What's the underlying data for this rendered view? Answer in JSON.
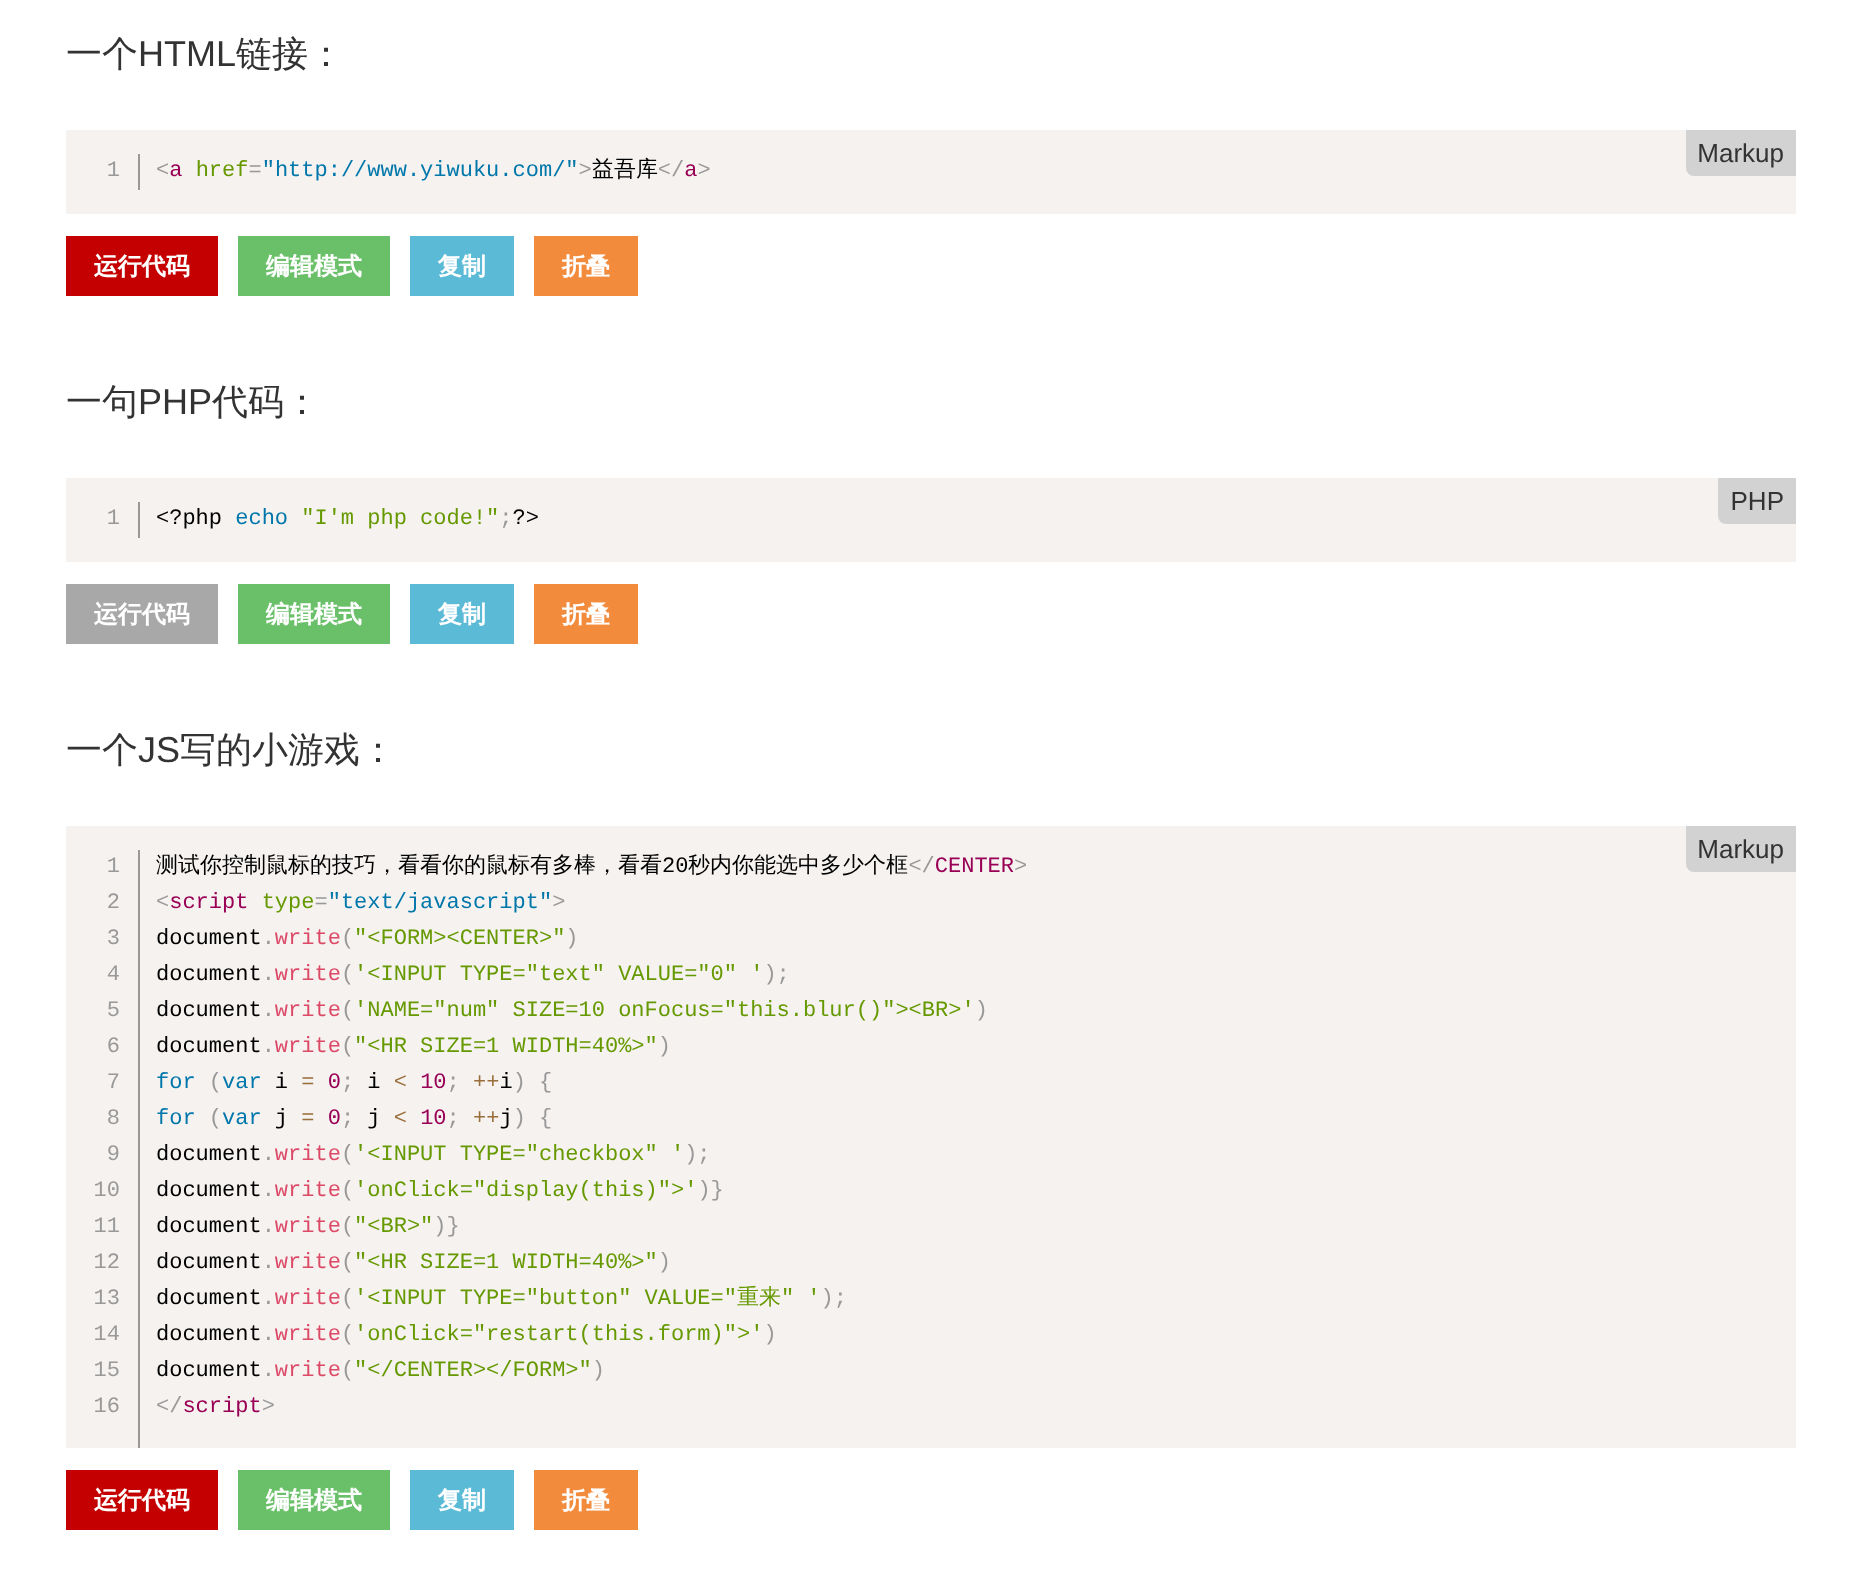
{
  "sections": [
    {
      "heading": "一个HTML链接：",
      "language": "Markup",
      "lines": [
        {
          "number": "1",
          "tokens": [
            {
              "kind": "punct",
              "text": "<"
            },
            {
              "kind": "tag",
              "text": "a"
            },
            {
              "kind": "attr",
              "text": " href"
            },
            {
              "kind": "punct",
              "text": "="
            },
            {
              "kind": "attrval",
              "text": "\"http://www.yiwuku.com/\""
            },
            {
              "kind": "punct",
              "text": ">"
            },
            {
              "kind": "plain",
              "text": "益吾库"
            },
            {
              "kind": "punct",
              "text": "</"
            },
            {
              "kind": "tag",
              "text": "a"
            },
            {
              "kind": "punct",
              "text": ">"
            }
          ]
        }
      ],
      "buttons": [
        {
          "label": "运行代码",
          "kind": "run",
          "disabled": false
        },
        {
          "label": "编辑模式",
          "kind": "edit",
          "disabled": false
        },
        {
          "label": "复制",
          "kind": "copy",
          "disabled": false
        },
        {
          "label": "折叠",
          "kind": "fold",
          "disabled": false
        }
      ]
    },
    {
      "heading": "一句PHP代码：",
      "language": "PHP",
      "lines": [
        {
          "number": "1",
          "tokens": [
            {
              "kind": "plain",
              "text": "<?php"
            },
            {
              "kind": "keyword",
              "text": " echo"
            },
            {
              "kind": "string",
              "text": " \"I'm php code!\""
            },
            {
              "kind": "punct",
              "text": ";"
            },
            {
              "kind": "plain",
              "text": "?>"
            }
          ]
        }
      ],
      "buttons": [
        {
          "label": "运行代码",
          "kind": "run",
          "disabled": true
        },
        {
          "label": "编辑模式",
          "kind": "edit",
          "disabled": false
        },
        {
          "label": "复制",
          "kind": "copy",
          "disabled": false
        },
        {
          "label": "折叠",
          "kind": "fold",
          "disabled": false
        }
      ]
    },
    {
      "heading": "一个JS写的小游戏：",
      "language": "Markup",
      "lines": [
        {
          "number": "1",
          "tokens": [
            {
              "kind": "plain",
              "text": "测试你控制鼠标的技巧，看看你的鼠标有多棒，看看20秒内你能选中多少个框"
            },
            {
              "kind": "punct",
              "text": "</"
            },
            {
              "kind": "tag",
              "text": "CENTER"
            },
            {
              "kind": "punct",
              "text": ">"
            }
          ]
        },
        {
          "number": "2",
          "tokens": [
            {
              "kind": "punct",
              "text": "<"
            },
            {
              "kind": "tag",
              "text": "script"
            },
            {
              "kind": "attr",
              "text": " type"
            },
            {
              "kind": "punct",
              "text": "="
            },
            {
              "kind": "attrval",
              "text": "\"text/javascript\""
            },
            {
              "kind": "punct",
              "text": ">"
            }
          ]
        },
        {
          "number": "3",
          "tokens": [
            {
              "kind": "plain",
              "text": "document"
            },
            {
              "kind": "punct",
              "text": "."
            },
            {
              "kind": "function",
              "text": "write"
            },
            {
              "kind": "punct",
              "text": "("
            },
            {
              "kind": "string",
              "text": "\"<FORM><CENTER>\""
            },
            {
              "kind": "punct",
              "text": ")"
            }
          ]
        },
        {
          "number": "4",
          "tokens": [
            {
              "kind": "plain",
              "text": "document"
            },
            {
              "kind": "punct",
              "text": "."
            },
            {
              "kind": "function",
              "text": "write"
            },
            {
              "kind": "punct",
              "text": "("
            },
            {
              "kind": "string",
              "text": "'<INPUT TYPE=\"text\" VALUE=\"0\" '"
            },
            {
              "kind": "punct",
              "text": ");"
            }
          ]
        },
        {
          "number": "5",
          "tokens": [
            {
              "kind": "plain",
              "text": "document"
            },
            {
              "kind": "punct",
              "text": "."
            },
            {
              "kind": "function",
              "text": "write"
            },
            {
              "kind": "punct",
              "text": "("
            },
            {
              "kind": "string",
              "text": "'NAME=\"num\" SIZE=10 onFocus=\"this.blur()\"><BR>'"
            },
            {
              "kind": "punct",
              "text": ")"
            }
          ]
        },
        {
          "number": "6",
          "tokens": [
            {
              "kind": "plain",
              "text": "document"
            },
            {
              "kind": "punct",
              "text": "."
            },
            {
              "kind": "function",
              "text": "write"
            },
            {
              "kind": "punct",
              "text": "("
            },
            {
              "kind": "string",
              "text": "\"<HR SIZE=1 WIDTH=40%>\""
            },
            {
              "kind": "punct",
              "text": ")"
            }
          ]
        },
        {
          "number": "7",
          "tokens": [
            {
              "kind": "keyword",
              "text": "for"
            },
            {
              "kind": "punct",
              "text": " ("
            },
            {
              "kind": "keyword",
              "text": "var"
            },
            {
              "kind": "plain",
              "text": " i "
            },
            {
              "kind": "operator",
              "text": "="
            },
            {
              "kind": "number",
              "text": " 0"
            },
            {
              "kind": "punct",
              "text": ";"
            },
            {
              "kind": "plain",
              "text": " i "
            },
            {
              "kind": "operator",
              "text": "<"
            },
            {
              "kind": "number",
              "text": " 10"
            },
            {
              "kind": "punct",
              "text": ";"
            },
            {
              "kind": "operator",
              "text": " ++"
            },
            {
              "kind": "plain",
              "text": "i"
            },
            {
              "kind": "punct",
              "text": ") {"
            }
          ]
        },
        {
          "number": "8",
          "tokens": [
            {
              "kind": "keyword",
              "text": "for"
            },
            {
              "kind": "punct",
              "text": " ("
            },
            {
              "kind": "keyword",
              "text": "var"
            },
            {
              "kind": "plain",
              "text": " j "
            },
            {
              "kind": "operator",
              "text": "="
            },
            {
              "kind": "number",
              "text": " 0"
            },
            {
              "kind": "punct",
              "text": ";"
            },
            {
              "kind": "plain",
              "text": " j "
            },
            {
              "kind": "operator",
              "text": "<"
            },
            {
              "kind": "number",
              "text": " 10"
            },
            {
              "kind": "punct",
              "text": ";"
            },
            {
              "kind": "operator",
              "text": " ++"
            },
            {
              "kind": "plain",
              "text": "j"
            },
            {
              "kind": "punct",
              "text": ") {"
            }
          ]
        },
        {
          "number": "9",
          "tokens": [
            {
              "kind": "plain",
              "text": "document"
            },
            {
              "kind": "punct",
              "text": "."
            },
            {
              "kind": "function",
              "text": "write"
            },
            {
              "kind": "punct",
              "text": "("
            },
            {
              "kind": "string",
              "text": "'<INPUT TYPE=\"checkbox\" '"
            },
            {
              "kind": "punct",
              "text": ");"
            }
          ]
        },
        {
          "number": "10",
          "tokens": [
            {
              "kind": "plain",
              "text": "document"
            },
            {
              "kind": "punct",
              "text": "."
            },
            {
              "kind": "function",
              "text": "write"
            },
            {
              "kind": "punct",
              "text": "("
            },
            {
              "kind": "string",
              "text": "'onClick=\"display(this)\">'"
            },
            {
              "kind": "punct",
              "text": ")}"
            }
          ]
        },
        {
          "number": "11",
          "tokens": [
            {
              "kind": "plain",
              "text": "document"
            },
            {
              "kind": "punct",
              "text": "."
            },
            {
              "kind": "function",
              "text": "write"
            },
            {
              "kind": "punct",
              "text": "("
            },
            {
              "kind": "string",
              "text": "\"<BR>\""
            },
            {
              "kind": "punct",
              "text": ")}"
            }
          ]
        },
        {
          "number": "12",
          "tokens": [
            {
              "kind": "plain",
              "text": "document"
            },
            {
              "kind": "punct",
              "text": "."
            },
            {
              "kind": "function",
              "text": "write"
            },
            {
              "kind": "punct",
              "text": "("
            },
            {
              "kind": "string",
              "text": "\"<HR SIZE=1 WIDTH=40%>\""
            },
            {
              "kind": "punct",
              "text": ")"
            }
          ]
        },
        {
          "number": "13",
          "tokens": [
            {
              "kind": "plain",
              "text": "document"
            },
            {
              "kind": "punct",
              "text": "."
            },
            {
              "kind": "function",
              "text": "write"
            },
            {
              "kind": "punct",
              "text": "("
            },
            {
              "kind": "string",
              "text": "'<INPUT TYPE=\"button\" VALUE=\"重来\" '"
            },
            {
              "kind": "punct",
              "text": ");"
            }
          ]
        },
        {
          "number": "14",
          "tokens": [
            {
              "kind": "plain",
              "text": "document"
            },
            {
              "kind": "punct",
              "text": "."
            },
            {
              "kind": "function",
              "text": "write"
            },
            {
              "kind": "punct",
              "text": "("
            },
            {
              "kind": "string",
              "text": "'onClick=\"restart(this.form)\">'"
            },
            {
              "kind": "punct",
              "text": ")"
            }
          ]
        },
        {
          "number": "15",
          "tokens": [
            {
              "kind": "plain",
              "text": "document"
            },
            {
              "kind": "punct",
              "text": "."
            },
            {
              "kind": "function",
              "text": "write"
            },
            {
              "kind": "punct",
              "text": "("
            },
            {
              "kind": "string",
              "text": "\"</CENTER></FORM>\""
            },
            {
              "kind": "punct",
              "text": ")"
            }
          ]
        },
        {
          "number": "16",
          "tokens": [
            {
              "kind": "punct",
              "text": "</"
            },
            {
              "kind": "tag",
              "text": "script"
            },
            {
              "kind": "punct",
              "text": ">"
            }
          ]
        }
      ],
      "buttons": [
        {
          "label": "运行代码",
          "kind": "run",
          "disabled": false
        },
        {
          "label": "编辑模式",
          "kind": "edit",
          "disabled": false
        },
        {
          "label": "复制",
          "kind": "copy",
          "disabled": false
        },
        {
          "label": "折叠",
          "kind": "fold",
          "disabled": false
        }
      ]
    }
  ]
}
